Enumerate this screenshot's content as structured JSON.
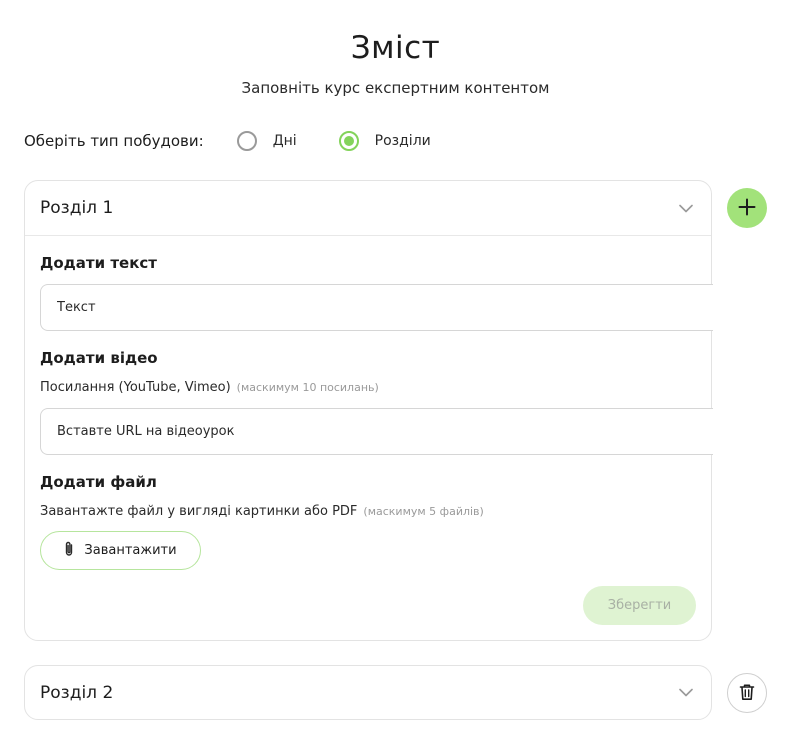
{
  "header": {
    "title": "Зміст",
    "subtitle": "Заповніть курс експертним контентом"
  },
  "build_type": {
    "label": "Оберіть тип побудови:",
    "options": [
      {
        "label": "Дні",
        "checked": false
      },
      {
        "label": "Розділи",
        "checked": true
      }
    ]
  },
  "sections": [
    {
      "title": "Розділ 1",
      "expanded": true,
      "text": {
        "label": "Додати текст",
        "placeholder": "Текст"
      },
      "video": {
        "label": "Додати відео",
        "sublabel": "Посилання (YouTube, Vimeo)",
        "hint": "(маскимум 10 посилань)",
        "placeholder": "Вставте URL на відеоурок"
      },
      "file": {
        "label": "Додати файл",
        "sublabel": "Завантажте файл у вигляді картинки або PDF",
        "hint": "(маскимум 5 файлів)",
        "upload_label": "Завантажити"
      },
      "save_label": "Зберегти"
    },
    {
      "title": "Розділ 2",
      "expanded": false
    }
  ],
  "icons": {
    "add": "plus-icon",
    "delete": "trash-icon",
    "chevron": "chevron-down-icon",
    "attach": "paperclip-icon"
  },
  "colors": {
    "accent": "#83d35b",
    "add_button_bg": "#a2e27a",
    "save_button_bg": "#dff3d2",
    "border": "#e3e3e3"
  }
}
